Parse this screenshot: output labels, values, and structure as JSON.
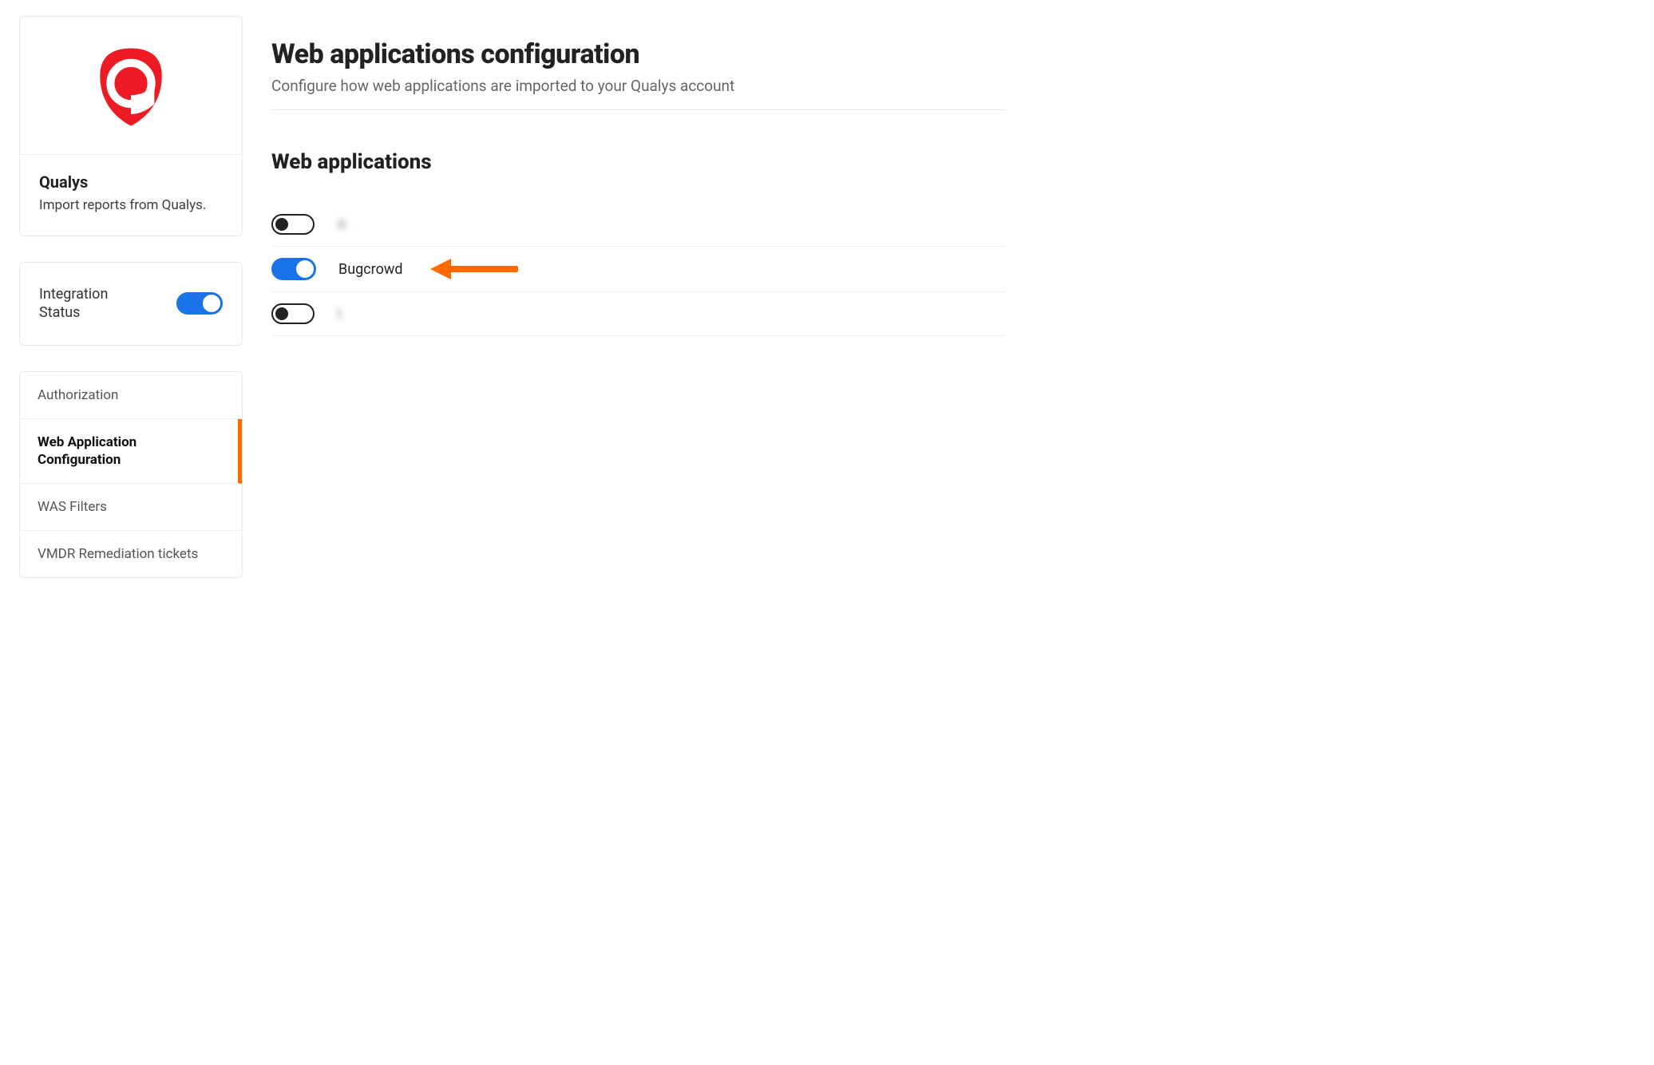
{
  "sidebar": {
    "product": {
      "name": "Qualys",
      "description": "Import reports from Qualys."
    },
    "integrationStatus": {
      "label": "Integration Status",
      "enabled": true
    },
    "nav": [
      {
        "label": "Authorization",
        "active": false
      },
      {
        "label": "Web Application Configuration",
        "active": true
      },
      {
        "label": "WAS Filters",
        "active": false
      },
      {
        "label": "VMDR Remediation tickets",
        "active": false
      }
    ]
  },
  "main": {
    "title": "Web applications configuration",
    "subtitle": "Configure how web applications are imported to your Qualys account",
    "sectionTitle": "Web applications",
    "apps": [
      {
        "label": "A",
        "enabled": false,
        "obscured": true
      },
      {
        "label": "Bugcrowd",
        "enabled": true,
        "obscured": false,
        "highlighted": true
      },
      {
        "label": "t",
        "enabled": false,
        "obscured": true
      }
    ]
  },
  "colors": {
    "accent": "#ff6a00",
    "toggleOn": "#1a73e8",
    "brandRed": "#ed1c24"
  }
}
